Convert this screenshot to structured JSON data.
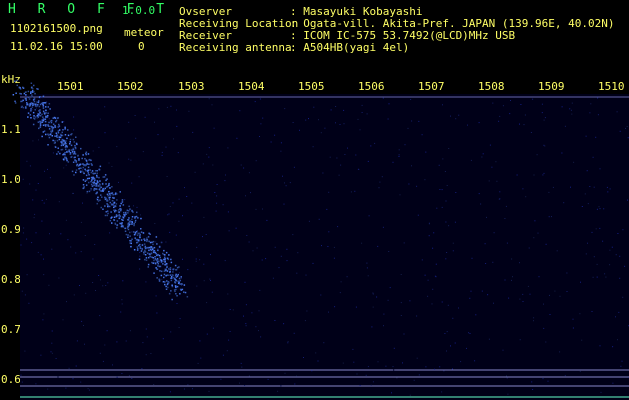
{
  "app": {
    "name": "H R O F F T",
    "version": "1.0.0"
  },
  "file": {
    "name": "1102161500.png",
    "datetime": "11.02.16 15:00"
  },
  "meteor": {
    "label": "meteor",
    "count": "0"
  },
  "info": [
    {
      "label": "Ovserver",
      "value": ": Masayuki Kobayashi"
    },
    {
      "label": "Receiving Location",
      "value": ": Ogata-vill. Akita-Pref. JAPAN (139.96E, 40.02N)"
    },
    {
      "label": "Receiver",
      "value": ": ICOM IC-575 53.7492(@LCD)MHz USB"
    },
    {
      "label": "Receiving antenna",
      "value": ": A504HB(yagi 4el)"
    }
  ],
  "axis": {
    "y_unit": "kHz",
    "x_ticks": [
      "1501",
      "1502",
      "1503",
      "1504",
      "1505",
      "1506",
      "1507",
      "1508",
      "1509",
      "1510"
    ],
    "y_ticks": [
      "1.1",
      "1.0",
      "0.9",
      "0.8",
      "0.7",
      "0.6"
    ]
  },
  "colors": {
    "text": "#ffff66",
    "title": "#33ff66",
    "signal": "#3366ff",
    "grid": "#8888cc"
  }
}
